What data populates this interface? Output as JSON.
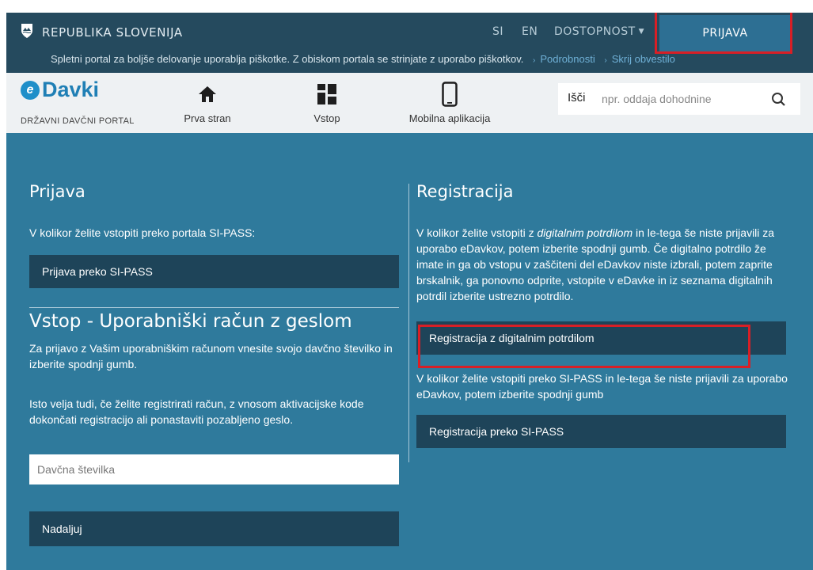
{
  "govbar": {
    "title": "REPUBLIKA SLOVENIJA",
    "lang_si": "SI",
    "lang_en": "EN",
    "accessibility": "DOSTOPNOST",
    "login_button": "PRIJAVA",
    "cookie_text": "Spletni portal za boljše delovanje uporablja piškotke. Z obiskom portala se strinjate z uporabo piškotkov.",
    "cookie_details": "Podrobnosti",
    "cookie_hide": "Skrij obvestilo"
  },
  "header": {
    "brand": "Davki",
    "brand_sub": "DRŽAVNI DAVČNI PORTAL",
    "nav": [
      {
        "label": "Prva stran",
        "icon": "home-icon"
      },
      {
        "label": "Vstop",
        "icon": "grid-icon"
      },
      {
        "label": "Mobilna aplikacija",
        "icon": "mobile-icon"
      }
    ],
    "search": {
      "label": "Išči",
      "placeholder": "npr. oddaja dohodnine"
    }
  },
  "left": {
    "prijava_title": "Prijava",
    "prijava_text": "V kolikor želite vstopiti preko portala SI-PASS:",
    "sipass_button": "Prijava preko SI-PASS",
    "vstop_title": "Vstop - Uporabniški račun z geslom",
    "vstop_text1": "Za prijavo z Vašim uporabniškim računom vnesite svojo davčno številko in izberite spodnji gumb.",
    "vstop_text2": "Isto velja tudi, če želite registrirati račun, z vnosom aktivacijske kode dokončati registracijo ali ponastaviti pozabljeno geslo.",
    "tax_placeholder": "Davčna številka",
    "continue_button": "Nadaljuj"
  },
  "right": {
    "registracija_title": "Registracija",
    "reg_text_prefix": "V kolikor želite vstopiti z ",
    "reg_text_em": "digitalnim potrdilom",
    "reg_text_rest": " in le-tega še niste prijavili za uporabo eDavkov, potem izberite spodnji gumb. Če digitalno potrdilo že imate in ga ob vstopu v zaščiteni del eDavkov niste izbrali, potem zaprite brskalnik, ga ponovno odprite, vstopite v eDavke in iz seznama digitalnih potrdil izberite ustrezno potrdilo.",
    "cert_button": "Registracija z digitalnim potrdilom",
    "sipass_text": "V kolikor želite vstopiti preko SI-PASS in le-tega še niste prijavili za uporabo eDavkov, potem izberite spodnji gumb",
    "sipass_button": "Registracija preko SI-PASS"
  },
  "colors": {
    "gov_bar": "#254a5e",
    "main_bg": "#2f7a9c",
    "button_dark": "#1e4459",
    "login_button": "#2d6f93",
    "highlight": "#d81f26",
    "brand_blue": "#1f7fb5"
  }
}
